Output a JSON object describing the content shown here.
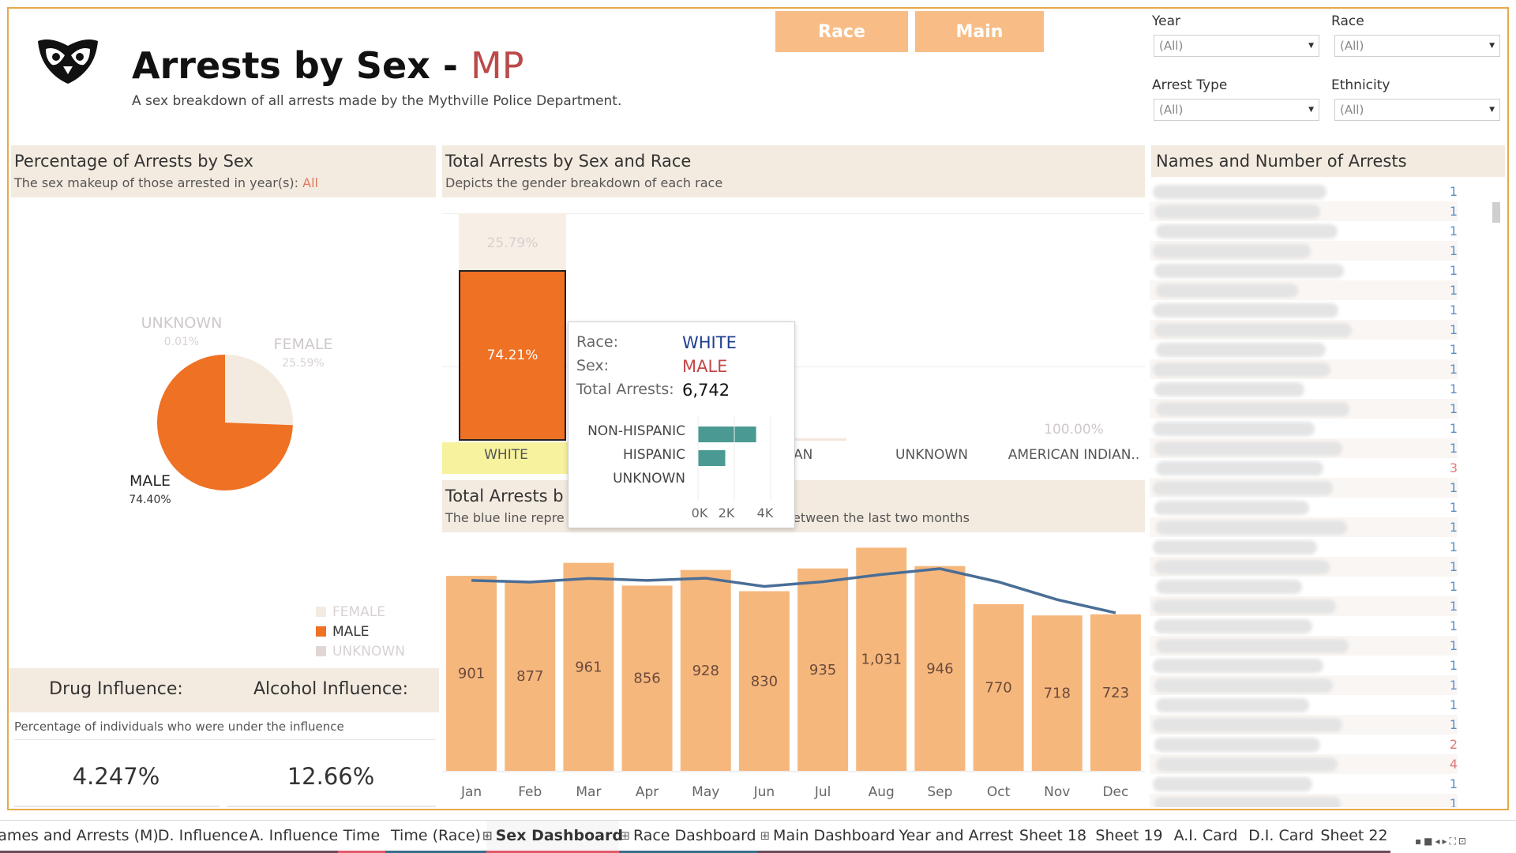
{
  "header": {
    "title": "Arrests by Sex",
    "title_sep": " - ",
    "title_accent": "MP",
    "subtitle": "A sex breakdown of all arrests made by the Mythville Police Department."
  },
  "nav_buttons": [
    "Race",
    "Main"
  ],
  "filters": [
    {
      "label": "Year",
      "value": "(All)"
    },
    {
      "label": "Race",
      "value": "(All)"
    },
    {
      "label": "Arrest Type",
      "value": "(All)"
    },
    {
      "label": "Ethnicity",
      "value": "(All)"
    }
  ],
  "pie_panel": {
    "title": "Percentage of Arrests by Sex",
    "subtitle_prefix": "The sex makeup of those arrested in year(s): ",
    "subtitle_value": "All",
    "slices": [
      {
        "label": "UNKNOWN",
        "pct": "0.01%",
        "value": 0.01,
        "color": "#e0d6d3"
      },
      {
        "label": "FEMALE",
        "pct": "25.59%",
        "value": 25.59,
        "color": "#f4ebe0"
      },
      {
        "label": "MALE",
        "pct": "74.40%",
        "value": 74.4,
        "color": "#ee7124"
      }
    ],
    "legend": [
      "FEMALE",
      "MALE",
      "UNKNOWN"
    ]
  },
  "kpis": {
    "drug_title": "Drug Influence:",
    "alcohol_title": "Alcohol Influence:",
    "subtitle": "Percentage of individuals who were under the influence",
    "drug_value": "4.247%",
    "alcohol_value": "12.66%"
  },
  "race_panel": {
    "title": "Total Arrests by Sex and Race",
    "subtitle": "Depicts the gender breakdown of each race",
    "white_female_pct": "25.79%",
    "white_male_pct": "74.21%",
    "aian_pct": "100.00%",
    "categories": [
      "WHITE",
      "AN",
      "UNKNOWN",
      "AMERICAN INDIAN.."
    ]
  },
  "tooltip": {
    "race_key": "Race:",
    "race_val": "WHITE",
    "sex_key": "Sex:",
    "sex_val": "MALE",
    "total_key": "Total Arrests:",
    "total_val": "6,742",
    "bars": [
      {
        "label": "NON-HISPANIC",
        "value": 3200
      },
      {
        "label": "HISPANIC",
        "value": 1500
      },
      {
        "label": "UNKNOWN",
        "value": 0
      }
    ],
    "axis": [
      "0K",
      "2K",
      "4K"
    ]
  },
  "month_panel": {
    "title_left": "Total Arrests b",
    "subtitle_left": "The blue line repre",
    "subtitle_right": "etween the last two months"
  },
  "names_panel": {
    "title": "Names and Number of Arrests",
    "counts": [
      "1",
      "1",
      "1",
      "1",
      "1",
      "1",
      "1",
      "1",
      "1",
      "1",
      "1",
      "1",
      "1",
      "1",
      "3",
      "1",
      "1",
      "1",
      "1",
      "1",
      "1",
      "1",
      "1",
      "1",
      "1",
      "1",
      "1",
      "1",
      "2",
      "4",
      "1",
      "1"
    ]
  },
  "chart_data": {
    "type": "bar",
    "categories": [
      "Jan",
      "Feb",
      "Mar",
      "Apr",
      "May",
      "Jun",
      "Jul",
      "Aug",
      "Sep",
      "Oct",
      "Nov",
      "Dec"
    ],
    "values": [
      901,
      877,
      961,
      856,
      928,
      830,
      935,
      1031,
      946,
      770,
      718,
      723
    ],
    "value_labels": [
      "901",
      "877",
      "961",
      "856",
      "928",
      "830",
      "935",
      "1,031",
      "946",
      "770",
      "718",
      "723"
    ],
    "line_values": [
      880,
      872,
      889,
      880,
      890,
      852,
      874,
      907,
      934,
      873,
      791,
      730
    ],
    "ylim": [
      0,
      1080
    ],
    "bar_color": "#f6b77d",
    "line_color": "#4a6e96"
  },
  "tabs": [
    {
      "label": "ames and Arrests (M)",
      "color": "#6b4a5c"
    },
    {
      "label": "D. Influence",
      "color": "#6b4a5c"
    },
    {
      "label": "A. Influence",
      "color": "#6b4a5c"
    },
    {
      "label": "Time",
      "color": "#e05a6a"
    },
    {
      "label": "Time (Race)",
      "color": "#3a6e8a"
    },
    {
      "label": "Sex Dashboard",
      "color": "#e05a6a",
      "active": true,
      "icon": "⊞"
    },
    {
      "label": "Race Dashboard",
      "color": "#3a6e8a",
      "icon": "⊞"
    },
    {
      "label": "Main Dashboard",
      "color": "#6b4a5c",
      "icon": "⊞"
    },
    {
      "label": "Year and Arrest",
      "color": "#6b4a5c"
    },
    {
      "label": "Sheet 18",
      "color": "#6b4a5c"
    },
    {
      "label": "Sheet 19",
      "color": "#6b4a5c"
    },
    {
      "label": "A.I. Card",
      "color": "#6b4a5c"
    },
    {
      "label": "D.I. Card",
      "color": "#6b4a5c"
    },
    {
      "label": "Sheet 22",
      "color": "#6b4a5c"
    }
  ]
}
